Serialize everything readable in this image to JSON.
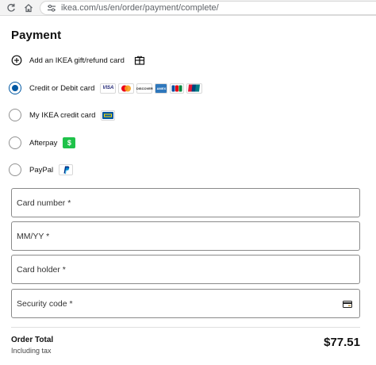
{
  "browser": {
    "url": "ikea.com/us/en/order/payment/complete/"
  },
  "page": {
    "title": "Payment"
  },
  "gift_card": {
    "label": "Add an IKEA gift/refund card"
  },
  "payment_methods": [
    {
      "label": "Credit or Debit card",
      "selected": true,
      "logos": [
        "VISA",
        "mastercard",
        "DISCOVER",
        "AMEX",
        "JCB",
        "UnionPay"
      ]
    },
    {
      "label": "My IKEA credit card",
      "selected": false,
      "logos": [
        "IKEA card"
      ]
    },
    {
      "label": "Afterpay",
      "selected": false,
      "logos": [
        "Afterpay"
      ]
    },
    {
      "label": "PayPal",
      "selected": false,
      "logos": [
        "PayPal"
      ]
    }
  ],
  "fields": {
    "card_number": "Card number *",
    "expiry": "MM/YY *",
    "card_holder": "Card holder *",
    "security_code": "Security code *"
  },
  "order": {
    "total_label": "Order Total",
    "tax_label": "Including tax",
    "total_amount": "$77.51"
  },
  "colors": {
    "accent": "#0058a3",
    "afterpay_green": "#1fc24a"
  }
}
